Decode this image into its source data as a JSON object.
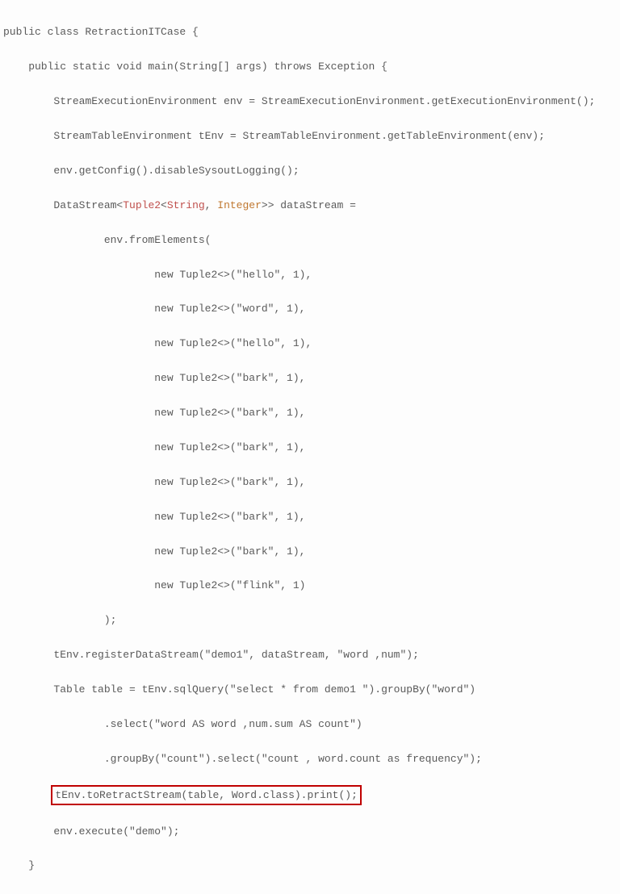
{
  "code": {
    "l1": "public class RetractionITCase {",
    "l2": "    public static void main(String[] args) throws Exception {",
    "l3": "        StreamExecutionEnvironment env = StreamExecutionEnvironment.getExecutionEnvironment();",
    "l4": "        StreamTableEnvironment tEnv = StreamTableEnvironment.getTableEnvironment(env);",
    "l5": "        env.getConfig().disableSysoutLogging();",
    "l6a": "        DataStream<",
    "l6b": "Tuple2",
    "l6c": "<",
    "l6d": "String",
    "l6e": ", ",
    "l6f": "Integer",
    "l6g": ">> dataStream =",
    "l7": "                env.fromElements(",
    "l8": "                        new Tuple2<>(\"hello\", 1),",
    "l9": "                        new Tuple2<>(\"word\", 1),",
    "l10": "                        new Tuple2<>(\"hello\", 1),",
    "l11": "                        new Tuple2<>(\"bark\", 1),",
    "l12": "                        new Tuple2<>(\"bark\", 1),",
    "l13": "                        new Tuple2<>(\"bark\", 1),",
    "l14": "                        new Tuple2<>(\"bark\", 1),",
    "l15": "                        new Tuple2<>(\"bark\", 1),",
    "l16": "                        new Tuple2<>(\"bark\", 1),",
    "l17": "                        new Tuple2<>(\"flink\", 1)",
    "l18": "                );",
    "l19": "        tEnv.registerDataStream(\"demo1\", dataStream, \"word ,num\");",
    "l20": "        Table table = tEnv.sqlQuery(\"select * from demo1 \").groupBy(\"word\")",
    "l21": "                .select(\"word AS word ,num.sum AS count\")",
    "l22": "                .groupBy(\"count\").select(\"count , word.count as frequency\");",
    "l23": "tEnv.toRetractStream(table, Word.class).print();",
    "l23_indent": "        ",
    "l24": "        env.execute(\"demo\");",
    "l25": "    }"
  }
}
